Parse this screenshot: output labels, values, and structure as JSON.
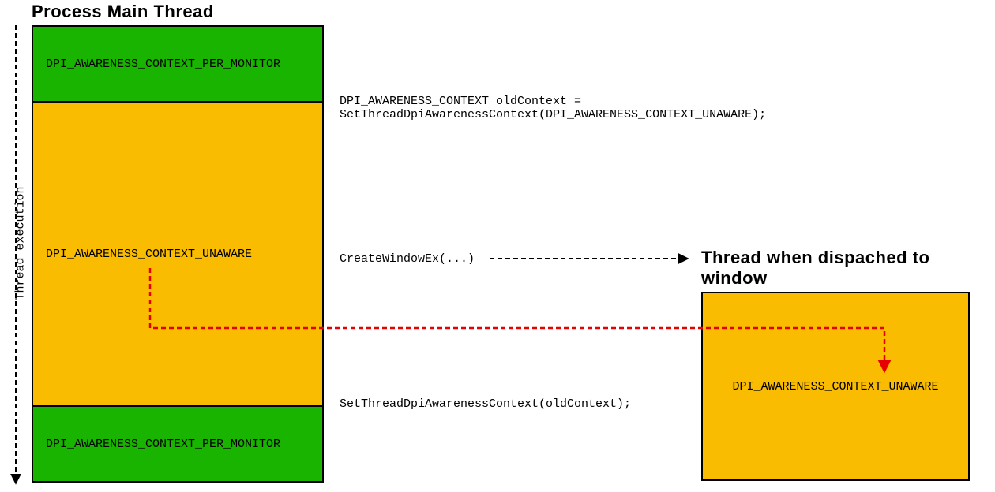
{
  "heading_main": "Process Main Thread",
  "heading_right": "Thread when dispached to window",
  "thread_exec_label": "Thread execution",
  "main_col": {
    "seg_top": "DPI_AWARENESS_CONTEXT_PER_MONITOR",
    "seg_mid": "DPI_AWARENESS_CONTEXT_UNAWARE",
    "seg_bottom": "DPI_AWARENESS_CONTEXT_PER_MONITOR"
  },
  "right_box_text": "DPI_AWARENESS_CONTEXT_UNAWARE",
  "annotations": {
    "a1_line1": "DPI_AWARENESS_CONTEXT oldContext =",
    "a1_line2": "SetThreadDpiAwarenessContext(DPI_AWARENESS_CONTEXT_UNAWARE);",
    "a2": "CreateWindowEx(...)",
    "a3": "SetThreadDpiAwarenessContext(oldContext);"
  }
}
